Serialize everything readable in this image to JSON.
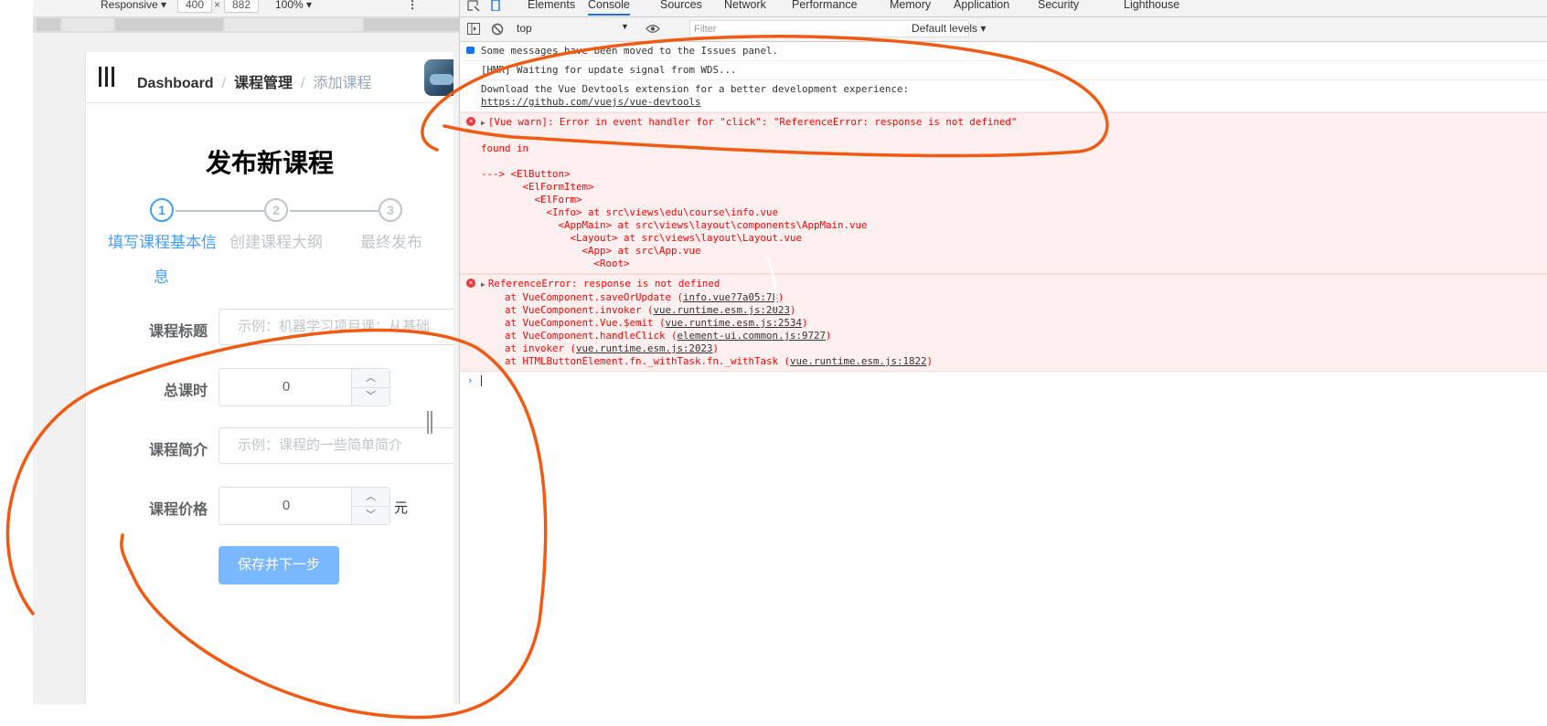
{
  "emulation": {
    "device": "Responsive ▾",
    "width": "400",
    "times": "×",
    "height": "882",
    "zoom": "100% ▾",
    "more": "⋮"
  },
  "app": {
    "breadcrumb": [
      "Dashboard",
      "课程管理",
      "添加课程"
    ],
    "breadcrumb_sep": "/",
    "title": "发布新课程",
    "steps": [
      {
        "number": "1",
        "label": "填写课程基本信",
        "label_wrap": "息"
      },
      {
        "number": "2",
        "label": "创建课程大纲"
      },
      {
        "number": "3",
        "label": "最终发布"
      }
    ],
    "form": {
      "title_label": "课程标题",
      "title_placeholder": "示例：机器学习项目课：从基础",
      "hours_label": "总课时",
      "hours_value": "0",
      "desc_label": "课程简介",
      "desc_placeholder": "示例：课程的一些简单简介",
      "price_label": "课程价格",
      "price_value": "0",
      "price_unit": "元",
      "submit_label": "保存并下一步"
    },
    "colors": {
      "primary": "#409eff",
      "disabled_button": "#79b8ff"
    }
  },
  "devtools": {
    "tabs": [
      "Elements",
      "Console",
      "Sources",
      "Network",
      "Performance",
      "Memory",
      "Application",
      "Security",
      "Lighthouse"
    ],
    "active_tab": "Console",
    "context": "top",
    "filter_placeholder": "Filter",
    "levels": "Default levels ▾",
    "messages": {
      "issues": "Some messages have been moved to the Issues panel.",
      "hmr": "[HMR] Waiting for update signal from WDS...",
      "devtools_line": "Download the Vue Devtools extension for a better development experience:",
      "devtools_link": "https://github.com/vuejs/vue-devtools",
      "vue_warn": "[Vue warn]: Error in event handler for \"click\": \"ReferenceError: response is not defined\"",
      "found_in": "found in",
      "tree": [
        "---> <ElButton>",
        "       <ElFormItem>",
        "         <ElForm>",
        "           <Info> at src\\views\\edu\\course\\info.vue",
        "             <AppMain> at src\\views\\layout\\components\\AppMain.vue",
        "               <Layout> at src\\views\\layout\\Layout.vue",
        "                 <App> at src\\App.vue",
        "                   <Root>"
      ],
      "ref_error": "ReferenceError: response is not defined",
      "stack": [
        {
          "text": "at VueComponent.saveOrUpdate (",
          "link": "info.vue?7a05:78"
        },
        {
          "text": "at VueComponent.invoker (",
          "link": "vue.runtime.esm.js:2023"
        },
        {
          "text": "at VueComponent.Vue.$emit (",
          "link": "vue.runtime.esm.js:2534"
        },
        {
          "text": "at VueComponent.handleClick (",
          "link": "element-ui.common.js:9727"
        },
        {
          "text": "at invoker (",
          "link": "vue.runtime.esm.js:2023"
        },
        {
          "text": "at HTMLButtonElement.fn._withTask.fn._withTask (",
          "link": "vue.runtime.esm.js:1822"
        }
      ],
      "prompt": "›"
    }
  },
  "annotation_color": "#f05a12"
}
